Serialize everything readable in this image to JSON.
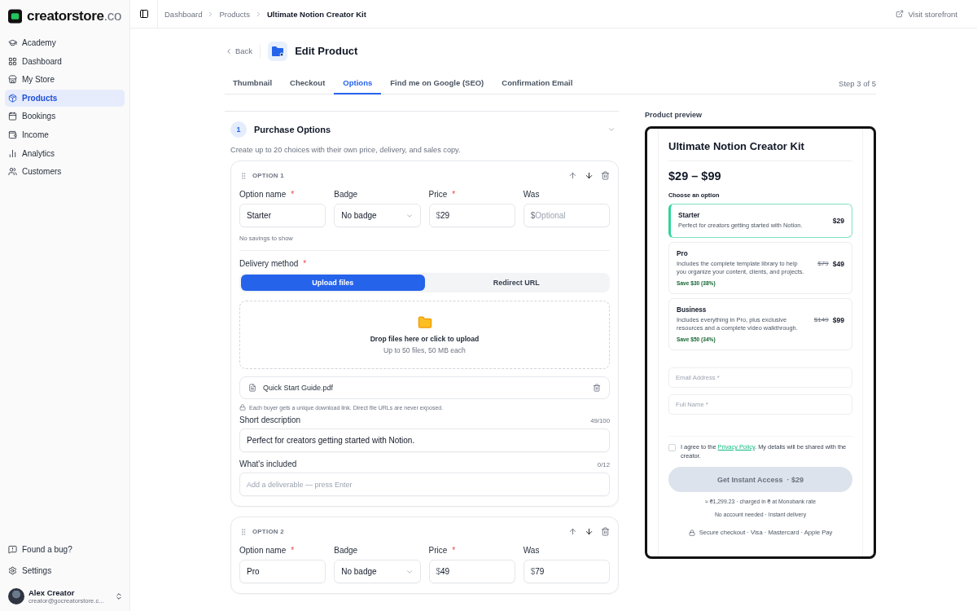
{
  "logo": {
    "name": "creatorstore",
    "suffix": ".co"
  },
  "sidebar": {
    "items": [
      {
        "label": "Academy",
        "selected": false
      },
      {
        "label": "Dashboard",
        "selected": false
      },
      {
        "label": "My Store",
        "selected": false
      },
      {
        "label": "Products",
        "selected": true
      },
      {
        "label": "Bookings",
        "selected": false
      },
      {
        "label": "Income",
        "selected": false
      },
      {
        "label": "Analytics",
        "selected": false
      },
      {
        "label": "Customers",
        "selected": false
      }
    ],
    "footer_items": [
      {
        "label": "Found a bug?"
      },
      {
        "label": "Settings"
      }
    ],
    "user": {
      "name": "Alex Creator",
      "email": "creator@gocreatorstore.c..."
    }
  },
  "breadcrumbs": [
    "Dashboard",
    "Products",
    "Ultimate Notion Creator Kit"
  ],
  "visit_storefront": "Visit storefront",
  "header": {
    "back": "Back",
    "title": "Edit Product"
  },
  "tabs": [
    {
      "label": "Thumbnail",
      "selected": false
    },
    {
      "label": "Checkout",
      "selected": false
    },
    {
      "label": "Options",
      "selected": true
    },
    {
      "label": "Find me on Google (SEO)",
      "selected": false
    },
    {
      "label": "Confirmation Email",
      "selected": false
    }
  ],
  "step": "Step 3 of 5",
  "section": {
    "number": "1",
    "title": "Purchase Options",
    "description": "Create up to 20 choices with their own price, delivery, and sales copy."
  },
  "options": [
    {
      "label": "OPTION 1",
      "fields": [
        {
          "label": "Option name",
          "required_mark": "*",
          "kind": "text",
          "value": "Starter"
        },
        {
          "label": "Badge",
          "kind": "select",
          "value": "No badge"
        },
        {
          "label": "Price",
          "required_mark": "*",
          "kind": "price",
          "prefix": "$",
          "value": "29"
        },
        {
          "label": "Was",
          "kind": "price",
          "prefix": "$",
          "placeholder": "Optional"
        }
      ],
      "hint": "No savings to show",
      "delivery": {
        "label": "Delivery method",
        "required_mark": "*",
        "choices": [
          {
            "label": "Upload files",
            "selected": true
          },
          {
            "label": "Redirect URL",
            "selected": false
          }
        ]
      },
      "upload": {
        "title": "Drop files here or click to upload",
        "subtitle": "Up to 50 files, 50 MB each"
      },
      "files": [
        "Quick Start Guide.pdf"
      ],
      "note": "Each buyer gets a unique download link. Direct file URLs are never exposed.",
      "short_description": {
        "label": "Short description",
        "count": "49/100",
        "value": "Perfect for creators getting started with Notion."
      },
      "included": {
        "label": "What's included",
        "count": "0/12",
        "placeholder": "Add a deliverable — press Enter"
      }
    },
    {
      "label": "OPTION 2",
      "fields": [
        {
          "label": "Option name",
          "required_mark": "*",
          "kind": "text",
          "value": "Pro"
        },
        {
          "label": "Badge",
          "kind": "select",
          "value": "No badge"
        },
        {
          "label": "Price",
          "required_mark": "*",
          "kind": "price",
          "prefix": "$",
          "value": "49"
        },
        {
          "label": "Was",
          "kind": "price",
          "prefix": "$",
          "value": "79"
        }
      ]
    }
  ],
  "preview": {
    "label": "Product preview",
    "title": "Ultimate Notion Creator Kit",
    "price_range": "$29 – $99",
    "choose_label": "Choose an option",
    "options": [
      {
        "name": "Starter",
        "description": "Perfect for creators getting started with Notion.",
        "price": "$29",
        "selected": true
      },
      {
        "name": "Pro",
        "description": "Includes the complete template library to help you organize your content, clients, and projects.",
        "old_price": "$79",
        "price": "$49",
        "savings": "Save $30 (38%)",
        "selected": false
      },
      {
        "name": "Business",
        "description": "Includes everything in Pro, plus exclusive resources and a complete video walkthrough.",
        "old_price": "$149",
        "price": "$99",
        "savings": "Save $50 (34%)",
        "selected": false
      }
    ],
    "fields": [
      {
        "placeholder": "Email Address *"
      },
      {
        "placeholder": "Full Name *"
      }
    ],
    "consent": {
      "checked": false,
      "before": "I agree to the ",
      "link": "Privacy Policy",
      "after": ". My details will be shared with the creator."
    },
    "cta": "Get Instant Access  · $29",
    "notes": [
      "≈ ₴1,299.23 · charged in ₴ at Monobank rate",
      "No account needed · Instant delivery"
    ],
    "secure": "Secure checkout · Visa · Mastercard · Apple Pay"
  }
}
